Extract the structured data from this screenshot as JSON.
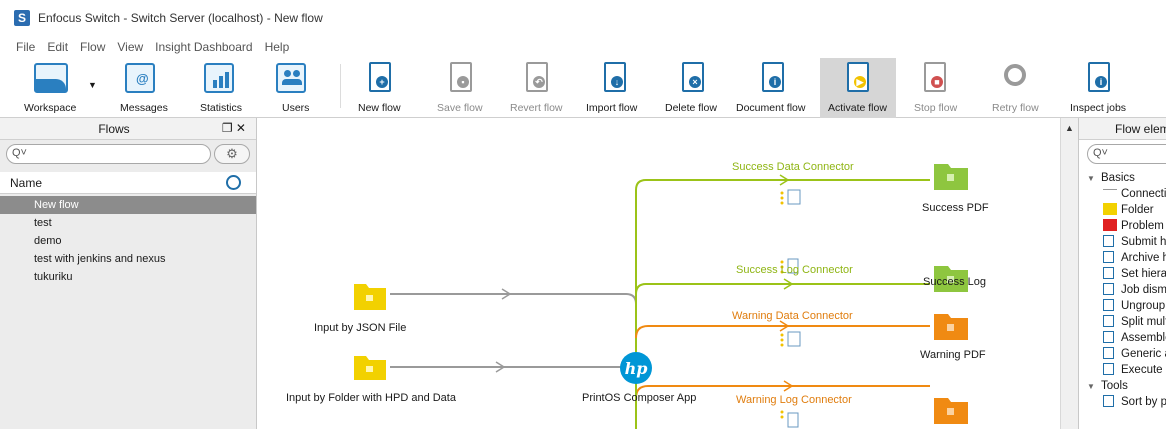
{
  "window": {
    "title": "Enfocus Switch - Switch Server (localhost) - New flow",
    "logo_letter": "S"
  },
  "menu": [
    "File",
    "Edit",
    "Flow",
    "View",
    "Insight Dashboard",
    "Help"
  ],
  "toolbar": {
    "workspace": "Workspace",
    "messages": "Messages",
    "statistics": "Statistics",
    "users": "Users",
    "new_flow": "New flow",
    "save_flow": "Save flow",
    "revert_flow": "Revert flow",
    "import_flow": "Import flow",
    "delete_flow": "Delete flow",
    "document_flow": "Document flow",
    "activate_flow": "Activate flow",
    "stop_flow": "Stop flow",
    "retry_flow": "Retry flow",
    "inspect_jobs": "Inspect jobs"
  },
  "flows_panel": {
    "title": "Flows",
    "controls": "❐ ✕",
    "search_prefix": "Q˅",
    "gear": "⚙",
    "column_name": "Name",
    "items": [
      "New flow",
      "test",
      "demo",
      "test with jenkins and nexus",
      "tukuriku"
    ],
    "selected_index": 0
  },
  "canvas": {
    "nodes": {
      "input_json": "Input by JSON File",
      "input_folder": "Input by Folder with HPD and Data",
      "printos": "PrintOS Composer App",
      "printos_logo": "hp",
      "success_pdf": "Success PDF",
      "success_log": "Success Log",
      "warning_pdf": "Warning PDF"
    },
    "connectors": {
      "success_data": "Success Data Connector",
      "success_log": "Success Log Connector",
      "warning_data": "Warning Data Connector",
      "warning_log": "Warning Log Connector"
    },
    "colors": {
      "success": "#9bc318",
      "warning": "#f08a12",
      "neutral": "#9a9a9a",
      "folder_yellow": "#f2d100",
      "folder_green": "#8ec63f",
      "folder_orange": "#f08a12",
      "hp_blue": "#0096d6"
    }
  },
  "elements_panel": {
    "title": "Flow elements",
    "search_prefix": "Q˅",
    "categories": [
      {
        "name": "Basics",
        "items": [
          "Connection",
          "Folder",
          "Problem jobs",
          "Submit hierarchy",
          "Archive hierarchy",
          "Set hierarchy path",
          "Job dismantler",
          "Ungroup job",
          "Split multi-job",
          "Assemble job",
          "Generic application",
          "Execute command"
        ]
      },
      {
        "name": "Tools",
        "items": [
          "Sort by preflight state"
        ]
      }
    ]
  }
}
